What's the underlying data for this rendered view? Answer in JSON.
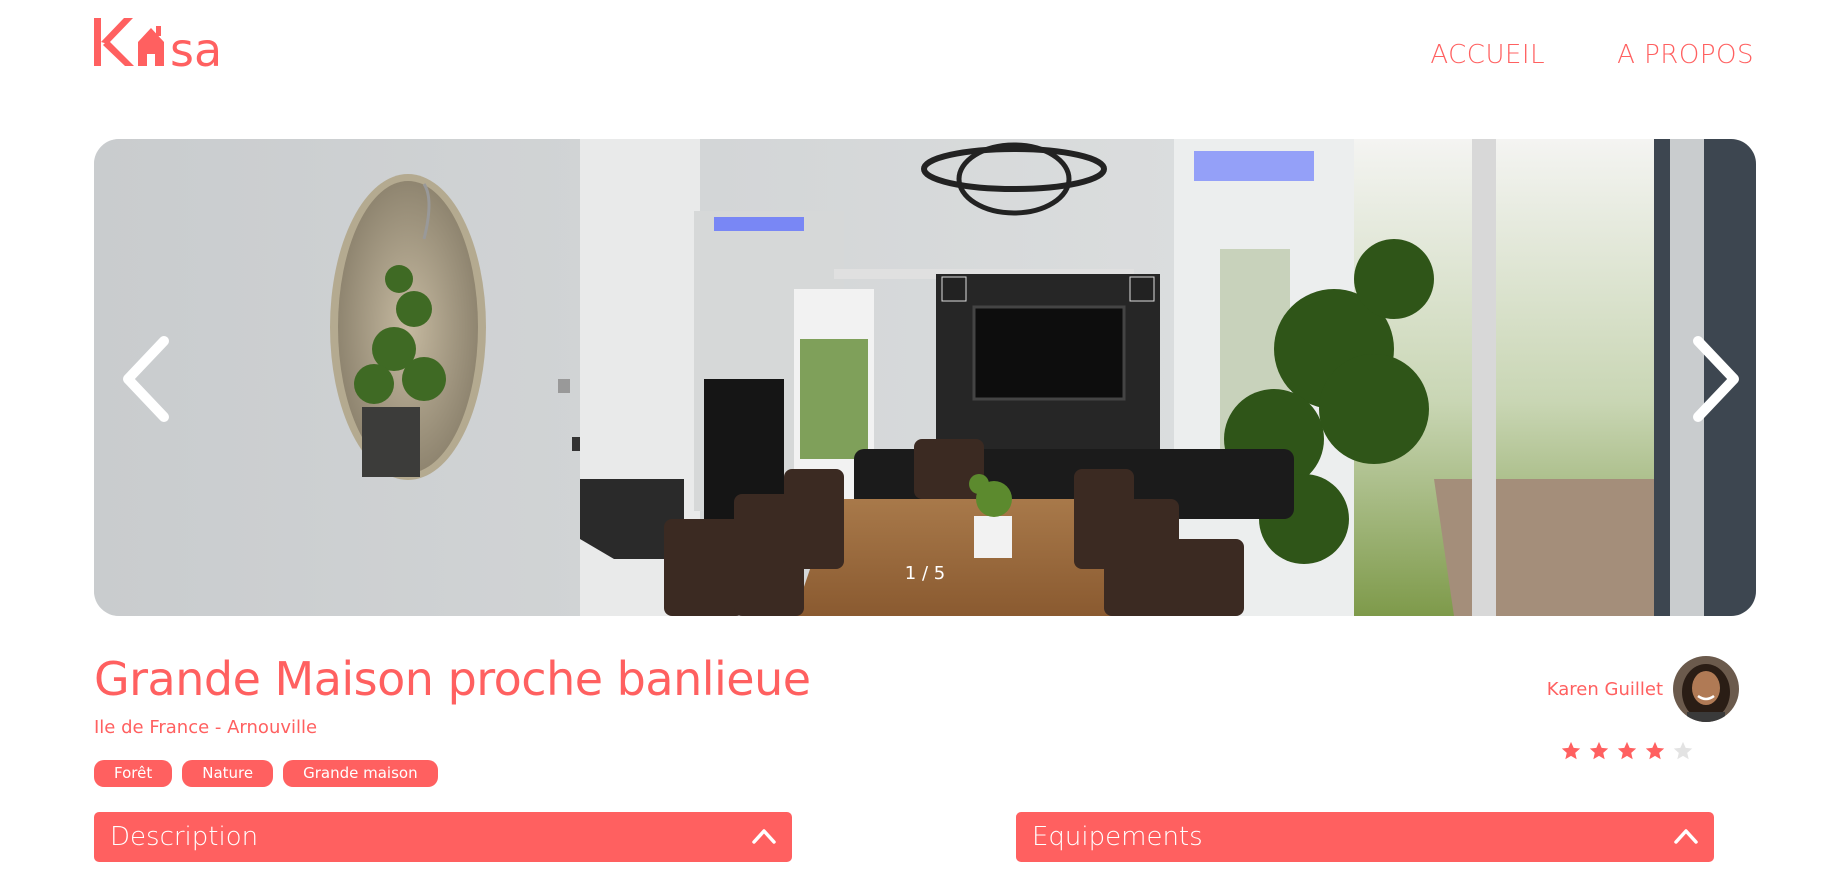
{
  "header": {
    "logo_text": "Kasa",
    "nav": {
      "home": "ACCUEIL",
      "about": "A PROPOS"
    }
  },
  "gallery": {
    "counter": "1 / 5",
    "prev_icon": "chevron-left-icon",
    "next_icon": "chevron-right-icon"
  },
  "listing": {
    "title": "Grande Maison proche banlieue",
    "location": "Ile de France - Arnouville",
    "tags": [
      "Forêt",
      "Nature",
      "Grande maison"
    ],
    "host": {
      "name": "Karen Guillet"
    },
    "rating": {
      "value": 4,
      "max": 5
    }
  },
  "collapses": {
    "description": "Description",
    "equipments": "Equipements"
  },
  "colors": {
    "accent": "#FF6060",
    "star_off": "#E3E3E3"
  }
}
